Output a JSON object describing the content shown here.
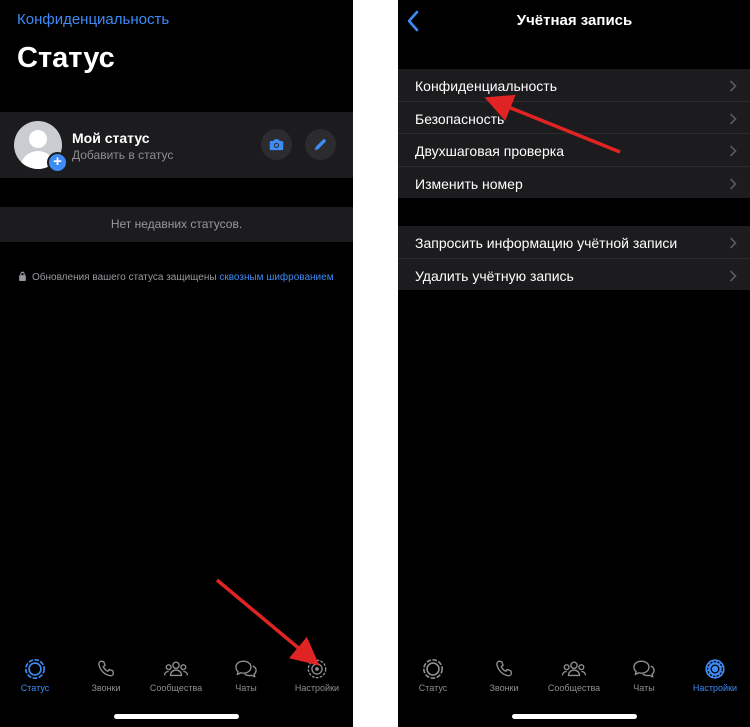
{
  "left_screen": {
    "back_label": "Конфиденциальность",
    "title": "Статус",
    "my_status": {
      "name": "Мой статус",
      "subtitle": "Добавить в статус",
      "camera_icon": "camera-icon",
      "edit_icon": "pencil-icon"
    },
    "empty_text": "Нет недавних статусов.",
    "encryption": {
      "text": "Обновления вашего статуса защищены ",
      "link": "сквозным шифрованием"
    },
    "tabs": [
      {
        "label": "Статус",
        "icon": "status-icon",
        "active": true
      },
      {
        "label": "Звонки",
        "icon": "phone-icon",
        "active": false
      },
      {
        "label": "Сообщества",
        "icon": "communities-icon",
        "active": false
      },
      {
        "label": "Чаты",
        "icon": "chats-icon",
        "active": false
      },
      {
        "label": "Настройки",
        "icon": "gear-icon",
        "active": false
      }
    ]
  },
  "right_screen": {
    "title": "Учётная запись",
    "group1": [
      {
        "label": "Конфиденциальность"
      },
      {
        "label": "Безопасность"
      },
      {
        "label": "Двухшаговая проверка"
      },
      {
        "label": "Изменить номер"
      }
    ],
    "group2": [
      {
        "label": "Запросить информацию учётной записи"
      },
      {
        "label": "Удалить учётную запись"
      }
    ],
    "tabs": [
      {
        "label": "Статус",
        "icon": "status-icon",
        "active": false
      },
      {
        "label": "Звонки",
        "icon": "phone-icon",
        "active": false
      },
      {
        "label": "Сообщества",
        "icon": "communities-icon",
        "active": false
      },
      {
        "label": "Чаты",
        "icon": "chats-icon",
        "active": false
      },
      {
        "label": "Настройки",
        "icon": "gear-icon",
        "active": true
      }
    ]
  },
  "colors": {
    "accent": "#3e8bf5",
    "background": "#000000",
    "cell": "#1c1c1e",
    "annotation_arrow": "#e02424"
  }
}
